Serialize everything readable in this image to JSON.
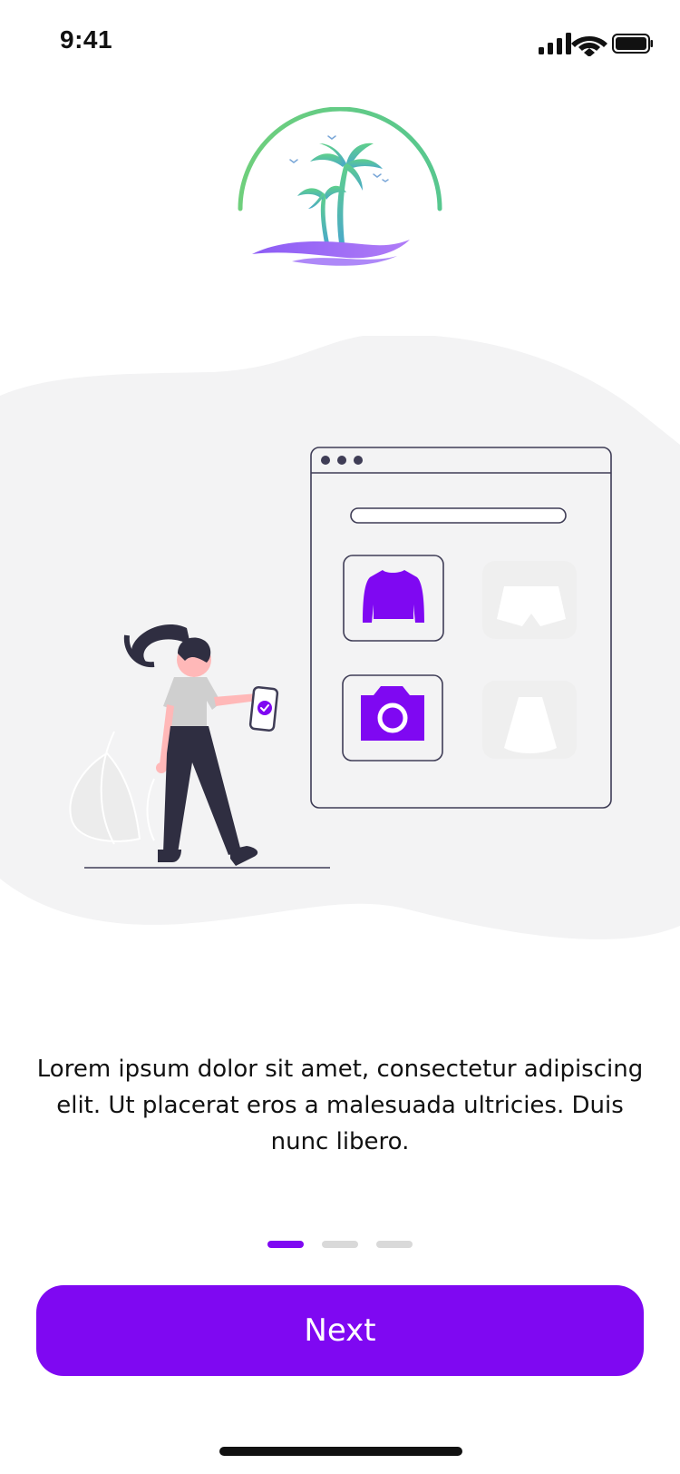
{
  "status_bar": {
    "time": "9:41",
    "icons": [
      "cellular-signal-icon",
      "wifi-icon",
      "battery-icon"
    ]
  },
  "logo": {
    "icon": "palm-island-logo"
  },
  "illustration": {
    "icons": [
      "browser-window",
      "sweater-icon",
      "shorts-icon",
      "camera-icon",
      "skirt-icon",
      "woman-with-phone",
      "check-icon"
    ]
  },
  "onboarding": {
    "description": "Lorem ipsum dolor sit amet, consectetur adipiscing elit. Ut placerat eros a malesuada ultricies. Duis nunc libero."
  },
  "pager": {
    "total": 3,
    "active_index": 0
  },
  "actions": {
    "next_label": "Next"
  },
  "colors": {
    "accent": "#7f08f2",
    "blob": "#f3f3f4",
    "ink": "#3f3d56",
    "inactive_dot": "#d9d9d9"
  }
}
